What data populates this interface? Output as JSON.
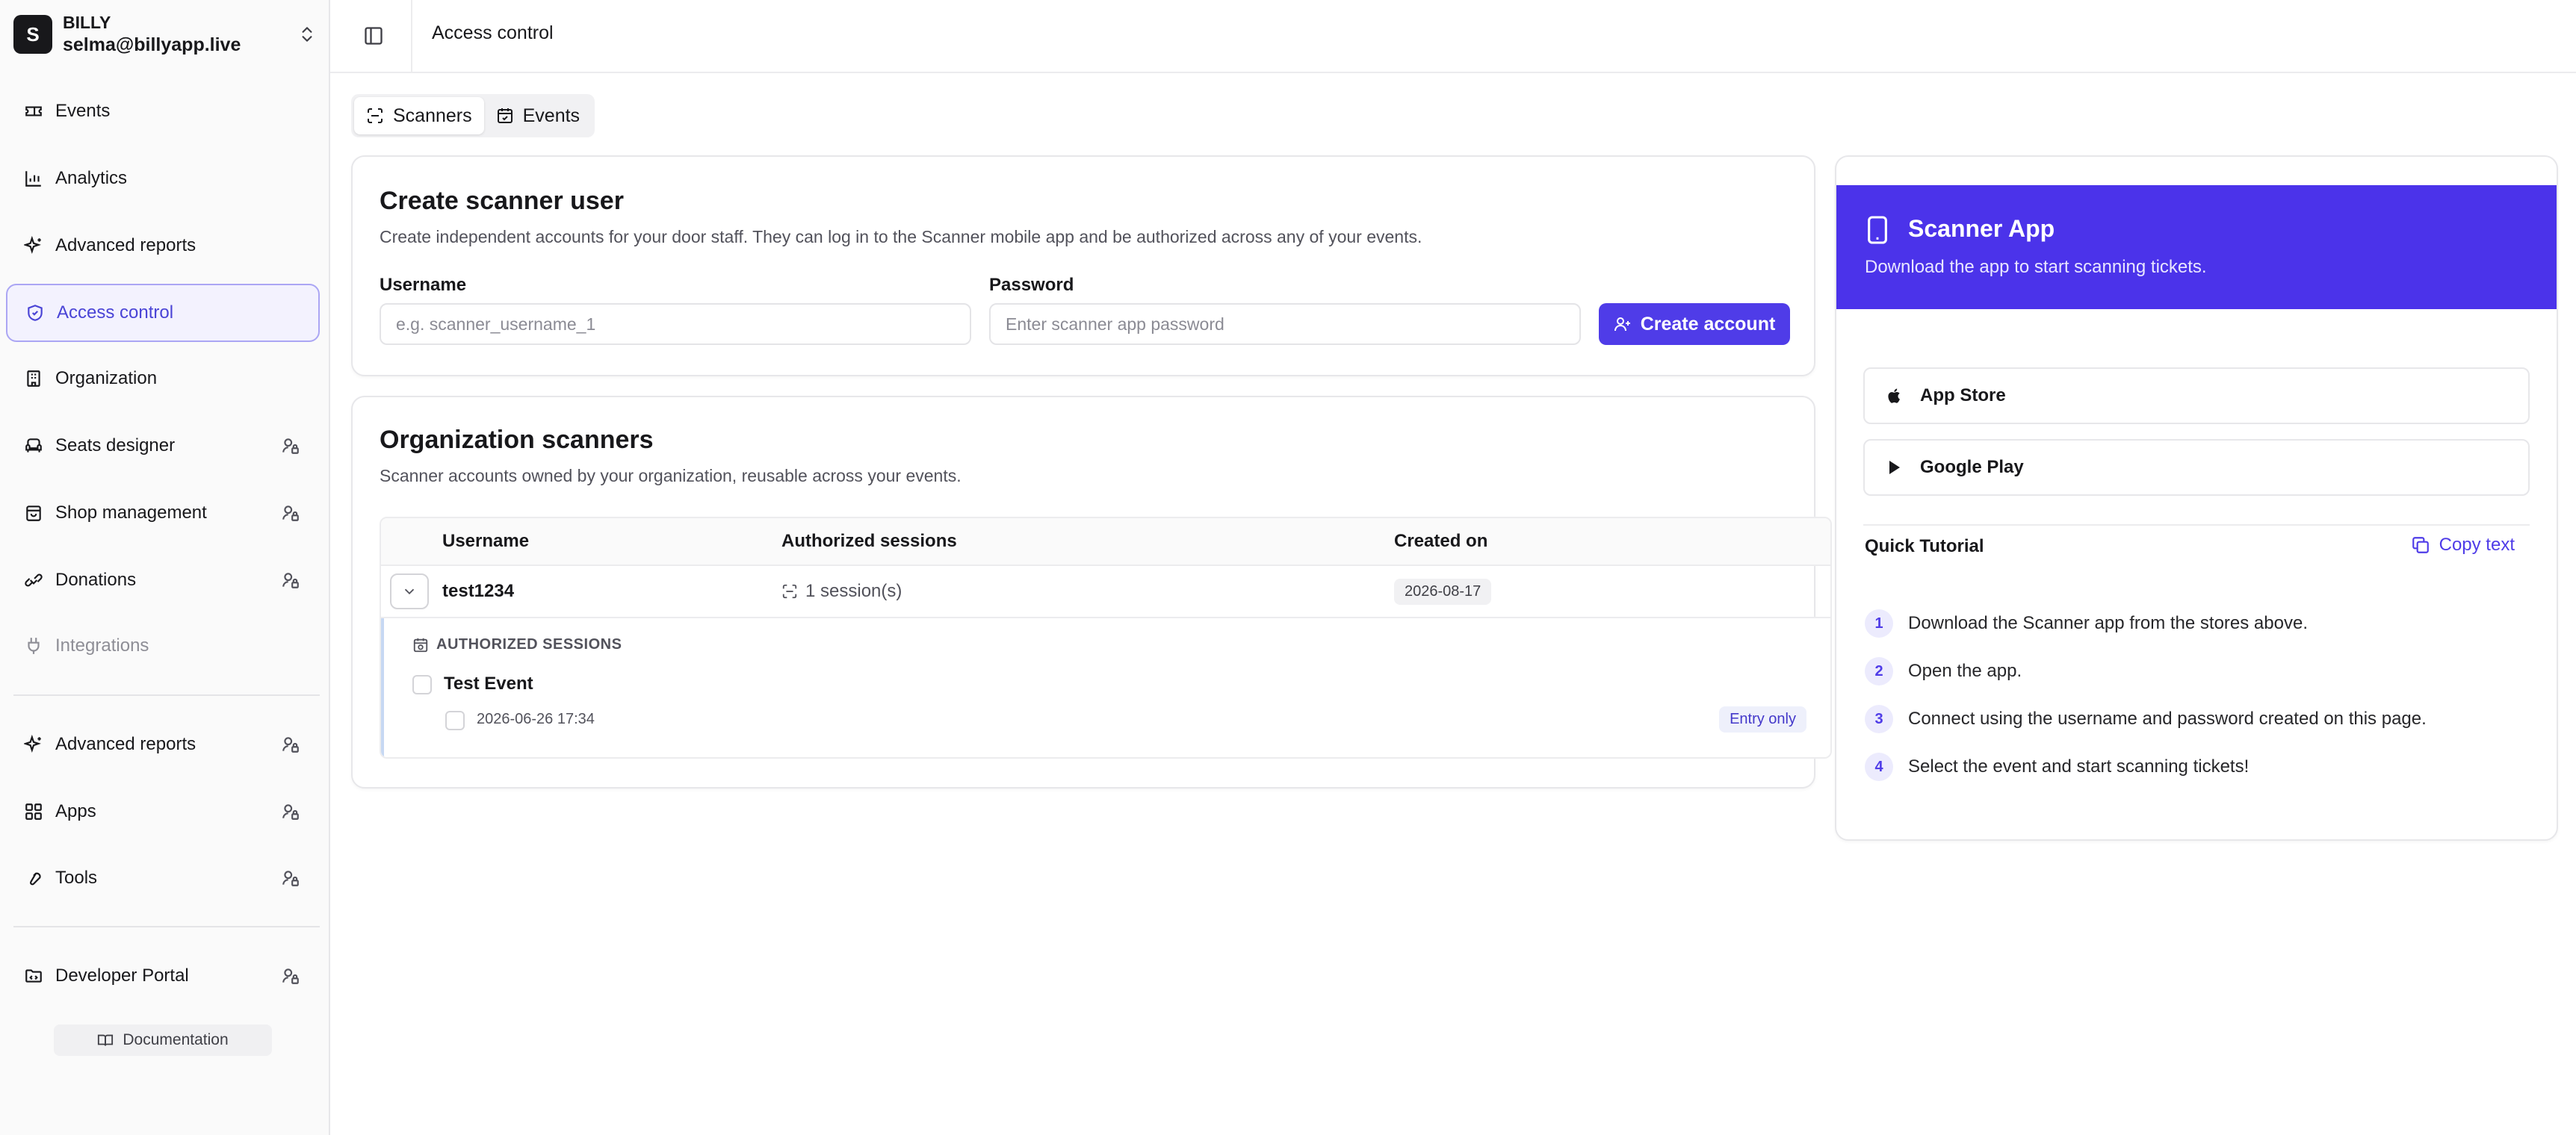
{
  "org": {
    "initial": "S",
    "name": "BILLY",
    "email": "selma@billyapp.live"
  },
  "sidebar": {
    "items": [
      {
        "label": "Events"
      },
      {
        "label": "Analytics"
      },
      {
        "label": "Advanced reports"
      },
      {
        "label": "Access control"
      },
      {
        "label": "Organization"
      },
      {
        "label": "Seats designer"
      },
      {
        "label": "Shop management"
      },
      {
        "label": "Donations"
      },
      {
        "label": "Integrations"
      }
    ],
    "secondary": [
      {
        "label": "Advanced reports"
      },
      {
        "label": "Apps"
      },
      {
        "label": "Tools"
      }
    ],
    "developer": {
      "label": "Developer Portal"
    },
    "documentation": "Documentation"
  },
  "header": {
    "breadcrumb": "Access control"
  },
  "tabs": [
    {
      "label": "Scanners"
    },
    {
      "label": "Events"
    }
  ],
  "create": {
    "title": "Create scanner user",
    "desc": "Create independent accounts for your door staff. They can log in to the Scanner mobile app and be authorized across any of your events.",
    "username_label": "Username",
    "username_placeholder": "e.g. scanner_username_1",
    "password_label": "Password",
    "password_placeholder": "Enter scanner app password",
    "button": "Create account"
  },
  "scanners": {
    "title": "Organization scanners",
    "desc": "Scanner accounts owned by your organization, reusable across your events.",
    "columns": [
      "Username",
      "Authorized sessions",
      "Created on"
    ],
    "rows": [
      {
        "username": "test1234",
        "sessions": "1 session(s)",
        "created": "2026-08-17",
        "section_label": "AUTHORIZED SESSIONS",
        "event": "Test Event",
        "session_time": "2026-06-26 17:34",
        "session_badge": "Entry only"
      }
    ]
  },
  "app": {
    "title": "Scanner App",
    "subtitle": "Download the app to start scanning tickets.",
    "app_store": "App Store",
    "google_play": "Google Play",
    "tutorial_title": "Quick Tutorial",
    "copy": "Copy text",
    "steps": [
      {
        "n": "1",
        "text": "Download the Scanner app from the stores above."
      },
      {
        "n": "2",
        "text": "Open the app."
      },
      {
        "n": "3",
        "text": "Connect using the username and password created on this page."
      },
      {
        "n": "4",
        "text": "Select the event and start scanning tickets!"
      }
    ]
  },
  "colors": {
    "accent": "#4f3ce8",
    "banner": "#4b33ea",
    "active_nav_bg": "#f3f2fe"
  }
}
